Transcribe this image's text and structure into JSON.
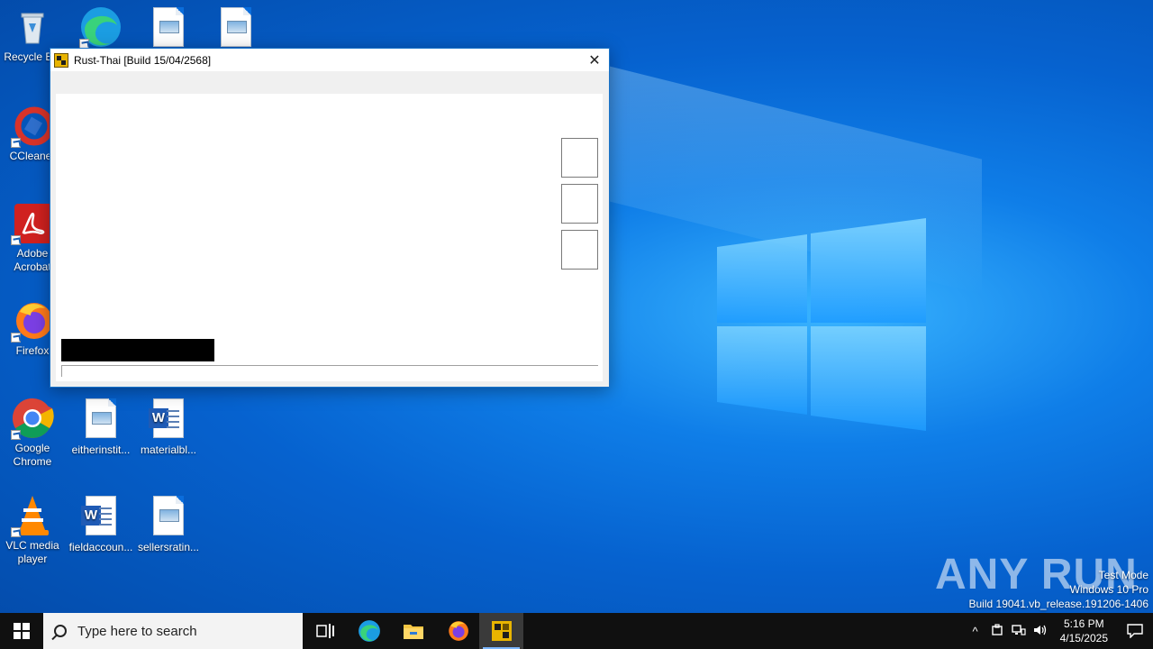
{
  "desktop": {
    "icons": [
      {
        "label": "Recycle Bin",
        "icon": "recycle-bin-icon"
      },
      {
        "label": "",
        "icon": "edge-icon"
      },
      {
        "label": "",
        "icon": "image-file-icon"
      },
      {
        "label": "",
        "icon": "image-file-icon"
      },
      {
        "label": "CCleaner",
        "icon": "ccleaner-icon"
      },
      {
        "label": "Adobe Acrobat",
        "icon": "acrobat-icon"
      },
      {
        "label": "Firefox",
        "icon": "firefox-icon"
      },
      {
        "label": "Google Chrome",
        "icon": "chrome-icon"
      },
      {
        "label": "eitherinstit...",
        "icon": "image-file-icon"
      },
      {
        "label": "materialbl...",
        "icon": "word-doc-icon"
      },
      {
        "label": "VLC media player",
        "icon": "vlc-icon"
      },
      {
        "label": "fieldaccoun...",
        "icon": "word-doc-icon"
      },
      {
        "label": "sellersratin...",
        "icon": "image-file-icon"
      }
    ]
  },
  "window": {
    "title": "Rust-Thai [Build 15/04/2568]",
    "close_glyph": "✕"
  },
  "watermark": {
    "brand": "ANY RUN",
    "line1": "Test Mode",
    "line2": "Windows 10 Pro",
    "line3": "Build 19041.vb_release.191206-1406"
  },
  "taskbar": {
    "search_placeholder": "Type here to search",
    "time": "5:16 PM",
    "date": "4/15/2025"
  },
  "colors": {
    "accent": "#0a6ddc",
    "taskbar": "#101010",
    "app_icon": "#e8b400"
  }
}
